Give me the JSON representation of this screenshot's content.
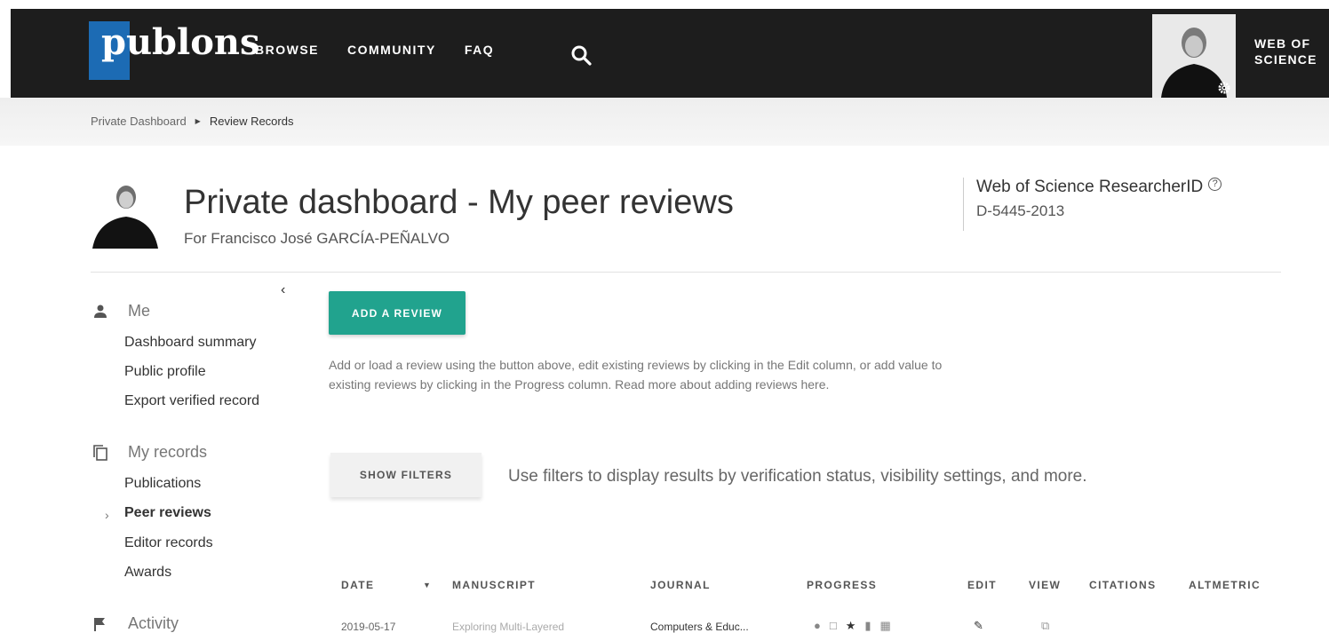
{
  "nav": {
    "logo": "publons",
    "links": [
      "BROWSE",
      "COMMUNITY",
      "FAQ"
    ],
    "wos_line1": "WEB OF",
    "wos_line2": "SCIENCE"
  },
  "breadcrumb": {
    "root": "Private Dashboard",
    "current": "Review Records"
  },
  "header": {
    "title": "Private dashboard - My peer reviews",
    "subtitle": "For Francisco José GARCÍA-PEÑALVO",
    "rid_label": "Web of Science ResearcherID",
    "rid_value": "D-5445-2013"
  },
  "sidebar": {
    "me": {
      "label": "Me",
      "items": [
        "Dashboard summary",
        "Public profile",
        "Export verified record"
      ]
    },
    "records": {
      "label": "My records",
      "items": [
        "Publications",
        "Peer reviews",
        "Editor records",
        "Awards"
      ]
    },
    "activity": {
      "label": "Activity"
    }
  },
  "main": {
    "add_button": "ADD A REVIEW",
    "intro_line1": "Add or load a review using the button above, edit existing reviews by clicking in the Edit column, or add value to",
    "intro_line2": "existing reviews by clicking in the Progress column. Read more about adding reviews here.",
    "filters_button": "SHOW FILTERS",
    "filters_hint": "Use filters to display results by verification status, visibility settings, and more."
  },
  "table": {
    "headers": [
      "DATE",
      "MANUSCRIPT",
      "JOURNAL",
      "PROGRESS",
      "EDIT",
      "VIEW",
      "CITATIONS",
      "ALTMETRIC"
    ],
    "row1": {
      "date": "2019-05-17",
      "manuscript": "Exploring Multi-Layered",
      "journal": "Computers & Educ..."
    }
  },
  "colors": {
    "topbar": "#1d1d1d",
    "logo_blue": "#1c6bb4",
    "accent_green": "#21a38e"
  }
}
